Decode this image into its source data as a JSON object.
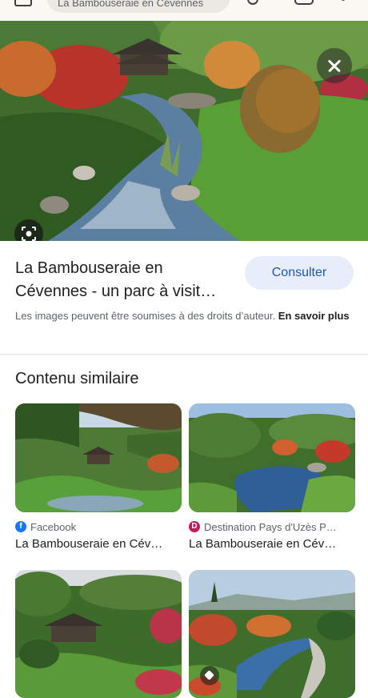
{
  "search": {
    "query": "La Bambouseraie en Cévennes"
  },
  "viewer": {
    "title": "La Bambouseraie en Cévennes - un parc à visit…",
    "consult_label": "Consulter",
    "rights_text": "Les images peuvent être soumises à des droits d’auteur. ",
    "learn_more": "En savoir plus"
  },
  "similar": {
    "heading": "Contenu similaire",
    "items": [
      {
        "source": "Facebook",
        "source_icon": "facebook-icon",
        "source_color": "#1877f2",
        "title": "La Bambouseraie en Cév…"
      },
      {
        "source": "Destination Pays d'Uzès P…",
        "source_icon": "destination-logo-icon",
        "source_color": "#c2185b",
        "title": "La Bambouseraie en Cév…"
      },
      {
        "source": "",
        "title": ""
      },
      {
        "source": "",
        "title": ""
      }
    ]
  }
}
